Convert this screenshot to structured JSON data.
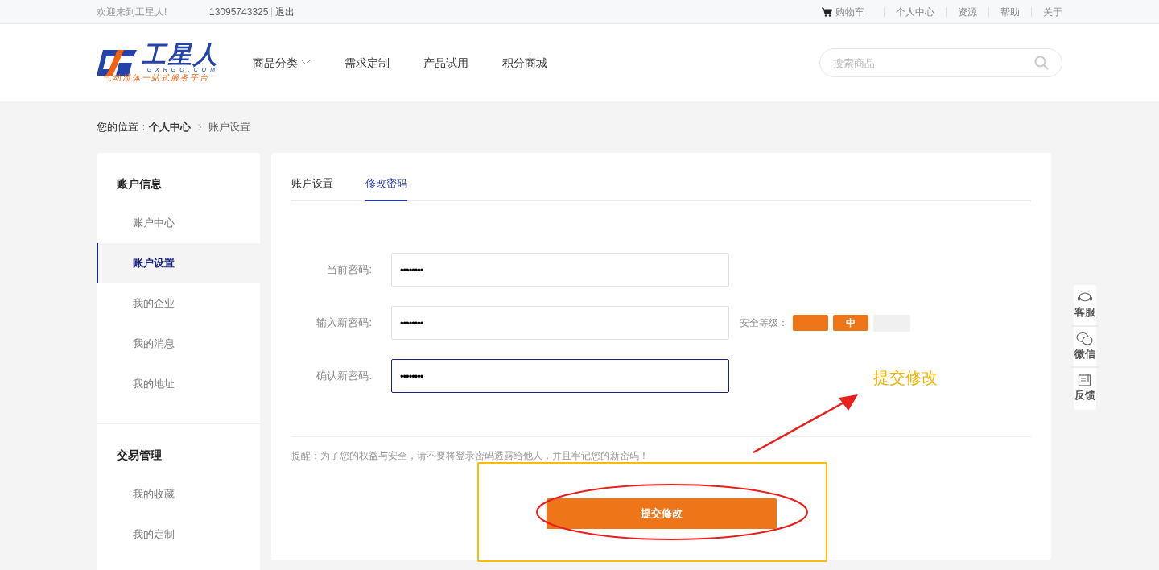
{
  "top_bar": {
    "welcome": "欢迎来到工星人!",
    "phone": "13095743325",
    "logout": "退出",
    "links": [
      {
        "kind": "cart",
        "label": "购物车"
      },
      {
        "kind": "plain",
        "label": "个人中心"
      },
      {
        "kind": "plain",
        "label": "资源"
      },
      {
        "kind": "plain",
        "label": "帮助"
      },
      {
        "kind": "plain",
        "label": "关于"
      }
    ]
  },
  "header": {
    "logo": {
      "name": "工星人",
      "domain": "GXRGO.COM",
      "slogan": "气动流体一站式服务平台"
    },
    "nav": [
      {
        "label": "商品分类",
        "dropdown": true
      },
      {
        "label": "需求定制",
        "dropdown": false
      },
      {
        "label": "产品试用",
        "dropdown": false
      },
      {
        "label": "积分商城",
        "dropdown": false
      }
    ],
    "search": {
      "placeholder": "搜索商品"
    }
  },
  "breadcrumb": {
    "prefix": "您的位置：",
    "parent": "个人中心",
    "current": "账户设置"
  },
  "sidebar": {
    "groups": [
      {
        "title": "账户信息",
        "items": [
          {
            "label": "账户中心",
            "selected": false
          },
          {
            "label": "账户设置",
            "selected": true
          },
          {
            "label": "我的企业",
            "selected": false
          },
          {
            "label": "我的消息",
            "selected": false
          },
          {
            "label": "我的地址",
            "selected": false
          }
        ]
      },
      {
        "title": "交易管理",
        "items": [
          {
            "label": "我的收藏",
            "selected": false
          },
          {
            "label": "我的定制",
            "selected": false
          }
        ]
      }
    ]
  },
  "tabs": [
    {
      "label": "账户设置",
      "selected": false
    },
    {
      "label": "修改密码",
      "selected": true
    }
  ],
  "form": {
    "fields": [
      {
        "label": "当前密码:",
        "value": "••••••••",
        "focused": false
      },
      {
        "label": "输入新密码:",
        "value": "••••••••",
        "focused": false
      },
      {
        "label": "确认新密码:",
        "value": "••••••••",
        "focused": true
      }
    ],
    "strength": {
      "label": "安全等级：",
      "segments": [
        {
          "filled": true
        },
        {
          "text": "中",
          "filled": true
        },
        {
          "filled": false
        }
      ]
    },
    "hint": "提醒：为了您的权益与安全，请不要将登录密码透露给他人，并且牢记您的新密码！",
    "submit": "提交修改"
  },
  "side_widget": [
    {
      "kind": "service",
      "label": "客服"
    },
    {
      "kind": "wechat",
      "label": "微信"
    },
    {
      "kind": "feedback",
      "label": "反馈"
    }
  ],
  "annotation": {
    "text": "提交修改"
  }
}
